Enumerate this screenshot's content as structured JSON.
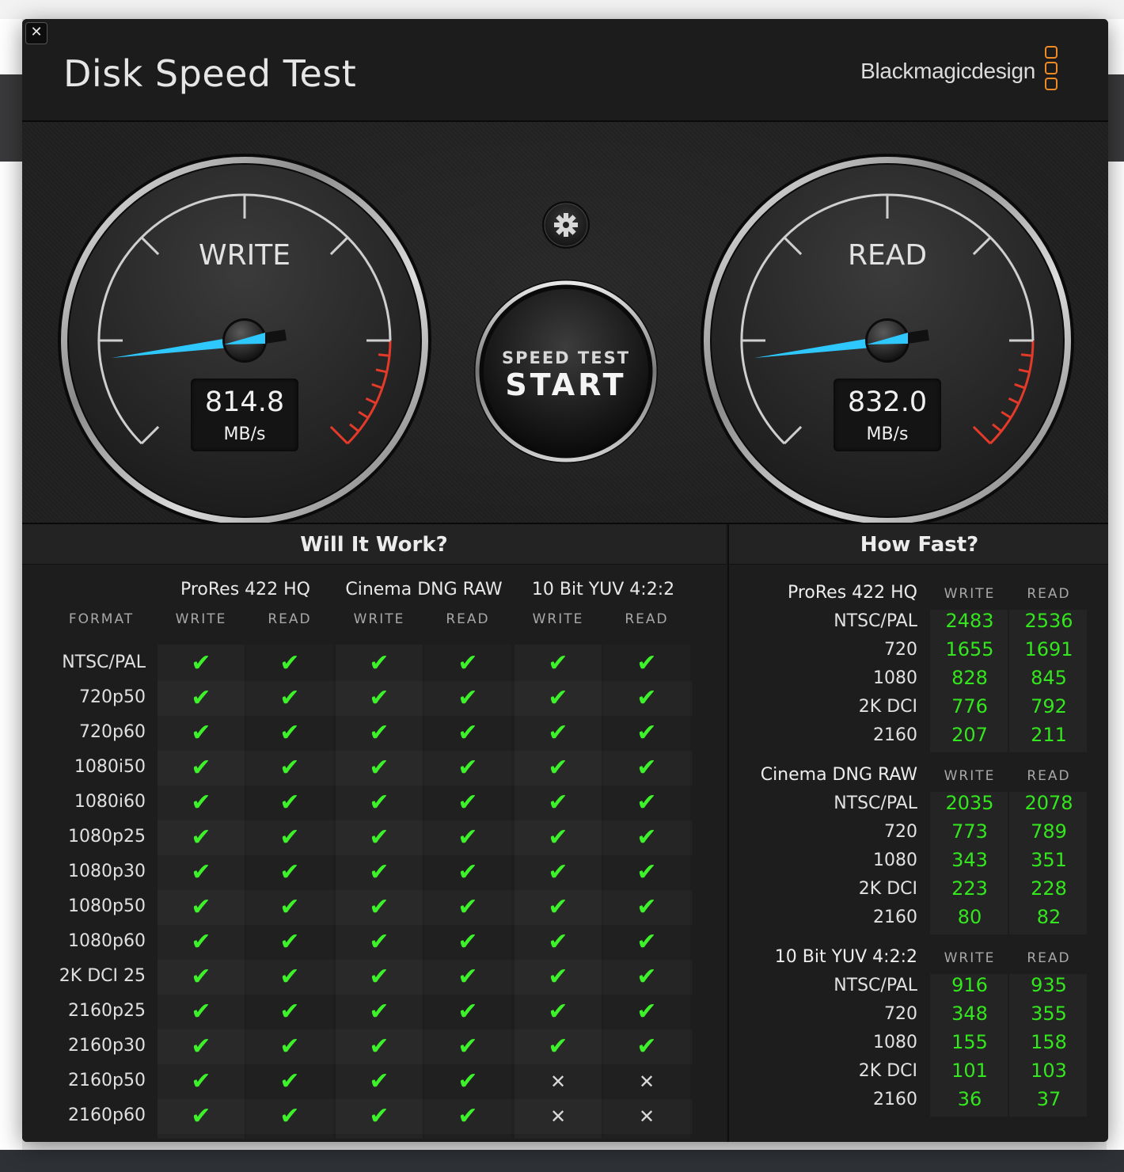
{
  "app": {
    "title": "Disk Speed Test",
    "brand": "Blackmagicdesign",
    "close_glyph": "✕"
  },
  "colors": {
    "accent_needle": "#2ec8ff",
    "redline": "#e33a2a",
    "pass": "#3df22a",
    "brand_orange": "#f08a24"
  },
  "gauges": {
    "write": {
      "label": "WRITE",
      "value": "814.8",
      "unit": "MB/s",
      "needle_fraction": 0.04
    },
    "read": {
      "label": "READ",
      "value": "832.0",
      "unit": "MB/s",
      "needle_fraction": 0.04
    }
  },
  "start_button": {
    "small": "SPEED TEST",
    "big": "START"
  },
  "settings_icon": "gear-icon",
  "will_it_work": {
    "title": "Will It Work?",
    "format_header": "FORMAT",
    "groups": [
      "ProRes 422 HQ",
      "Cinema DNG RAW",
      "10 Bit YUV 4:2:2"
    ],
    "sub_headers": [
      "WRITE",
      "READ",
      "WRITE",
      "READ",
      "WRITE",
      "READ"
    ],
    "rows": [
      {
        "format": "NTSC/PAL",
        "marks": [
          1,
          1,
          1,
          1,
          1,
          1
        ]
      },
      {
        "format": "720p50",
        "marks": [
          1,
          1,
          1,
          1,
          1,
          1
        ]
      },
      {
        "format": "720p60",
        "marks": [
          1,
          1,
          1,
          1,
          1,
          1
        ]
      },
      {
        "format": "1080i50",
        "marks": [
          1,
          1,
          1,
          1,
          1,
          1
        ]
      },
      {
        "format": "1080i60",
        "marks": [
          1,
          1,
          1,
          1,
          1,
          1
        ]
      },
      {
        "format": "1080p25",
        "marks": [
          1,
          1,
          1,
          1,
          1,
          1
        ]
      },
      {
        "format": "1080p30",
        "marks": [
          1,
          1,
          1,
          1,
          1,
          1
        ]
      },
      {
        "format": "1080p50",
        "marks": [
          1,
          1,
          1,
          1,
          1,
          1
        ]
      },
      {
        "format": "1080p60",
        "marks": [
          1,
          1,
          1,
          1,
          1,
          1
        ]
      },
      {
        "format": "2K DCI 25",
        "marks": [
          1,
          1,
          1,
          1,
          1,
          1
        ]
      },
      {
        "format": "2160p25",
        "marks": [
          1,
          1,
          1,
          1,
          1,
          1
        ]
      },
      {
        "format": "2160p30",
        "marks": [
          1,
          1,
          1,
          1,
          1,
          1
        ]
      },
      {
        "format": "2160p50",
        "marks": [
          1,
          1,
          1,
          1,
          0,
          0
        ]
      },
      {
        "format": "2160p60",
        "marks": [
          1,
          1,
          1,
          1,
          0,
          0
        ]
      }
    ],
    "check_glyph": "✔",
    "cross_glyph": "✕"
  },
  "how_fast": {
    "title": "How Fast?",
    "groups": [
      {
        "name": "ProRes 422 HQ",
        "write_header": "WRITE",
        "read_header": "READ",
        "rows": [
          {
            "label": "NTSC/PAL",
            "write": "2483",
            "read": "2536"
          },
          {
            "label": "720",
            "write": "1655",
            "read": "1691"
          },
          {
            "label": "1080",
            "write": "828",
            "read": "845"
          },
          {
            "label": "2K DCI",
            "write": "776",
            "read": "792"
          },
          {
            "label": "2160",
            "write": "207",
            "read": "211"
          }
        ]
      },
      {
        "name": "Cinema DNG RAW",
        "write_header": "WRITE",
        "read_header": "READ",
        "rows": [
          {
            "label": "NTSC/PAL",
            "write": "2035",
            "read": "2078"
          },
          {
            "label": "720",
            "write": "773",
            "read": "789"
          },
          {
            "label": "1080",
            "write": "343",
            "read": "351"
          },
          {
            "label": "2K DCI",
            "write": "223",
            "read": "228"
          },
          {
            "label": "2160",
            "write": "80",
            "read": "82"
          }
        ]
      },
      {
        "name": "10 Bit YUV 4:2:2",
        "write_header": "WRITE",
        "read_header": "READ",
        "rows": [
          {
            "label": "NTSC/PAL",
            "write": "916",
            "read": "935"
          },
          {
            "label": "720",
            "write": "348",
            "read": "355"
          },
          {
            "label": "1080",
            "write": "155",
            "read": "158"
          },
          {
            "label": "2K DCI",
            "write": "101",
            "read": "103"
          },
          {
            "label": "2160",
            "write": "36",
            "read": "37"
          }
        ]
      }
    ]
  }
}
